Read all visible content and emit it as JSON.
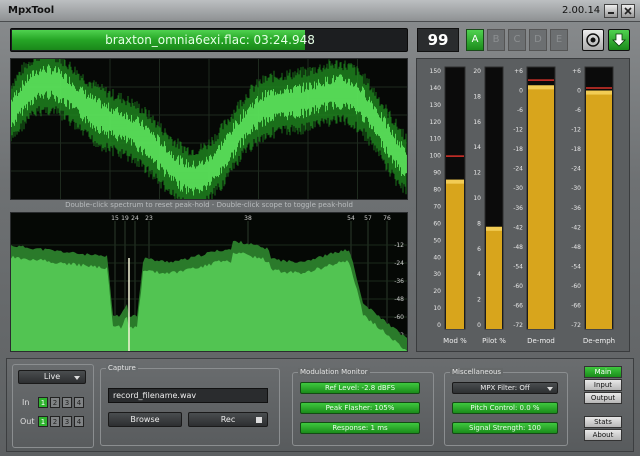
{
  "window": {
    "title": "MpxTool",
    "version": "2.00.14"
  },
  "track": {
    "text": "braxton_omnia6exi.flac: 03:24.948",
    "progress": 0.74
  },
  "counter": "99",
  "slots": [
    {
      "label": "A",
      "active": true
    },
    {
      "label": "B",
      "active": false
    },
    {
      "label": "C",
      "active": false
    },
    {
      "label": "D",
      "active": false
    },
    {
      "label": "E",
      "active": false
    }
  ],
  "hint_text": "Double-click spectrum to reset peak-hold - Double-click scope to toggle peak-hold",
  "spectrum_markers": [
    "15",
    "19",
    "24",
    "23",
    "38",
    "54",
    "57",
    "76"
  ],
  "spectrum_db_ticks": [
    "-12",
    "-24",
    "-36",
    "-48",
    "-60",
    "-72"
  ],
  "meters": [
    {
      "label": "Mod %",
      "ticks": [
        "150",
        "140",
        "130",
        "120",
        "110",
        "100",
        "90",
        "80",
        "70",
        "60",
        "50",
        "40",
        "30",
        "20",
        "10",
        "0"
      ],
      "level": 0.57,
      "peak": 0.66
    },
    {
      "label": "Pilot %",
      "ticks": [
        "20",
        "18",
        "16",
        "14",
        "12",
        "10",
        "8",
        "6",
        "4",
        "2",
        "0"
      ],
      "level": 0.39,
      "peak": null
    },
    {
      "label": "De-mod",
      "ticks": [
        "+6",
        "0",
        "-6",
        "-12",
        "-18",
        "-24",
        "-30",
        "-36",
        "-42",
        "-48",
        "-54",
        "-60",
        "-66",
        "-72"
      ],
      "level": 0.93,
      "peak": 0.95
    },
    {
      "label": "De-emph",
      "ticks": [
        "+6",
        "0",
        "-6",
        "-12",
        "-18",
        "-24",
        "-30",
        "-36",
        "-42",
        "-48",
        "-54",
        "-60",
        "-66",
        "-72"
      ],
      "level": 0.91,
      "peak": 0.92
    }
  ],
  "bottom": {
    "live_label": "Live",
    "in_label": "In",
    "out_label": "Out",
    "numbers": [
      "1",
      "2",
      "3",
      "4"
    ],
    "capture": {
      "title": "Capture",
      "filename": "record_filename.wav",
      "browse_label": "Browse",
      "rec_label": "Rec"
    },
    "modulation": {
      "title": "Modulation Monitor",
      "ref_level": "Ref Level: -2.8 dBFS",
      "peak_flasher": "Peak Flasher: 105%",
      "response": "Response: 1 ms"
    },
    "misc": {
      "title": "Miscellaneous",
      "mpx_filter": "MPX Filter: Off",
      "pitch_control": "Pitch Control: 0.0 %",
      "signal_strength": "Signal Strength: 100"
    },
    "side_buttons": [
      {
        "label": "Main",
        "active": true
      },
      {
        "label": "Input",
        "active": false
      },
      {
        "label": "Output",
        "active": false
      },
      {
        "label": "Stats",
        "active": false
      },
      {
        "label": "About",
        "active": false
      }
    ]
  },
  "colors": {
    "accent_green": "#26a526",
    "meter_gold": "#d8a51c",
    "peak_red": "#d8322a"
  }
}
